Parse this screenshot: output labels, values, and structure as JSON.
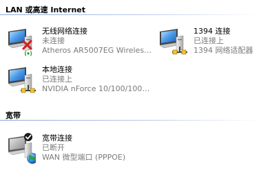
{
  "groups": [
    {
      "title": "LAN 或高速 Internet",
      "items": [
        {
          "name": "无线网络连接",
          "status": "未连接",
          "device": "Atheros AR5007EG Wireless N...",
          "icon": "wireless-network-disconnected-icon"
        },
        {
          "name": "1394 连接",
          "status": "已连接上",
          "device": "1394 网络适配器",
          "icon": "network-connected-icon"
        },
        {
          "name": "本地连接",
          "status": "已连接上",
          "device": "NVIDIA nForce 10/100/1000 ...",
          "icon": "network-connected-icon"
        }
      ]
    },
    {
      "title": "宽带",
      "items": [
        {
          "name": "宽带连接",
          "status": "已断开",
          "device": "WAN 微型端口 (PPPOE)",
          "icon": "broadband-disconnected-icon"
        }
      ]
    }
  ],
  "colors": {
    "header_rule": "#8aa6d8",
    "secondary_text": "#7a7a7a",
    "error_red": "#d42020"
  }
}
